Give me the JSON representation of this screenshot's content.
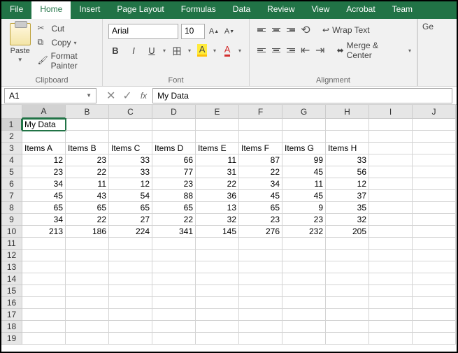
{
  "tabs": [
    "File",
    "Home",
    "Insert",
    "Page Layout",
    "Formulas",
    "Data",
    "Review",
    "View",
    "Acrobat",
    "Team"
  ],
  "activeTab": "Home",
  "clipboard": {
    "label": "Clipboard",
    "paste": "Paste",
    "cut": "Cut",
    "copy": "Copy",
    "formatPainter": "Format Painter"
  },
  "font": {
    "label": "Font",
    "name": "Arial",
    "size": "10"
  },
  "alignment": {
    "label": "Alignment",
    "wrap": "Wrap Text",
    "merge": "Merge & Center"
  },
  "ge": "Ge",
  "nameBox": "A1",
  "formulaBar": "My Data",
  "columns": [
    "A",
    "B",
    "C",
    "D",
    "E",
    "F",
    "G",
    "H",
    "I",
    "J"
  ],
  "rows": [
    "1",
    "2",
    "3",
    "4",
    "5",
    "6",
    "7",
    "8",
    "9",
    "10",
    "11",
    "12",
    "13",
    "14",
    "15",
    "16",
    "17",
    "18",
    "19"
  ],
  "data": {
    "A1": "My Data",
    "A3": "Items A",
    "B3": "Items B",
    "C3": "Items C",
    "D3": "Items D",
    "E3": "Items E",
    "F3": "Items F",
    "G3": "Items G",
    "H3": "Items H",
    "A4": "12",
    "B4": "23",
    "C4": "33",
    "D4": "66",
    "E4": "11",
    "F4": "87",
    "G4": "99",
    "H4": "33",
    "A5": "23",
    "B5": "22",
    "C5": "33",
    "D5": "77",
    "E5": "31",
    "F5": "22",
    "G5": "45",
    "H5": "56",
    "A6": "34",
    "B6": "11",
    "C6": "12",
    "D6": "23",
    "E6": "22",
    "F6": "34",
    "G6": "11",
    "H6": "12",
    "A7": "45",
    "B7": "43",
    "C7": "54",
    "D7": "88",
    "E7": "36",
    "F7": "45",
    "G7": "45",
    "H7": "37",
    "A8": "65",
    "B8": "65",
    "C8": "65",
    "D8": "65",
    "E8": "13",
    "F8": "65",
    "G8": "9",
    "H8": "35",
    "A9": "34",
    "B9": "22",
    "C9": "27",
    "D9": "22",
    "E9": "32",
    "F9": "23",
    "G9": "23",
    "H9": "32",
    "A10": "213",
    "B10": "186",
    "C10": "224",
    "D10": "341",
    "E10": "145",
    "F10": "276",
    "G10": "232",
    "H10": "205"
  },
  "selected": "A1"
}
